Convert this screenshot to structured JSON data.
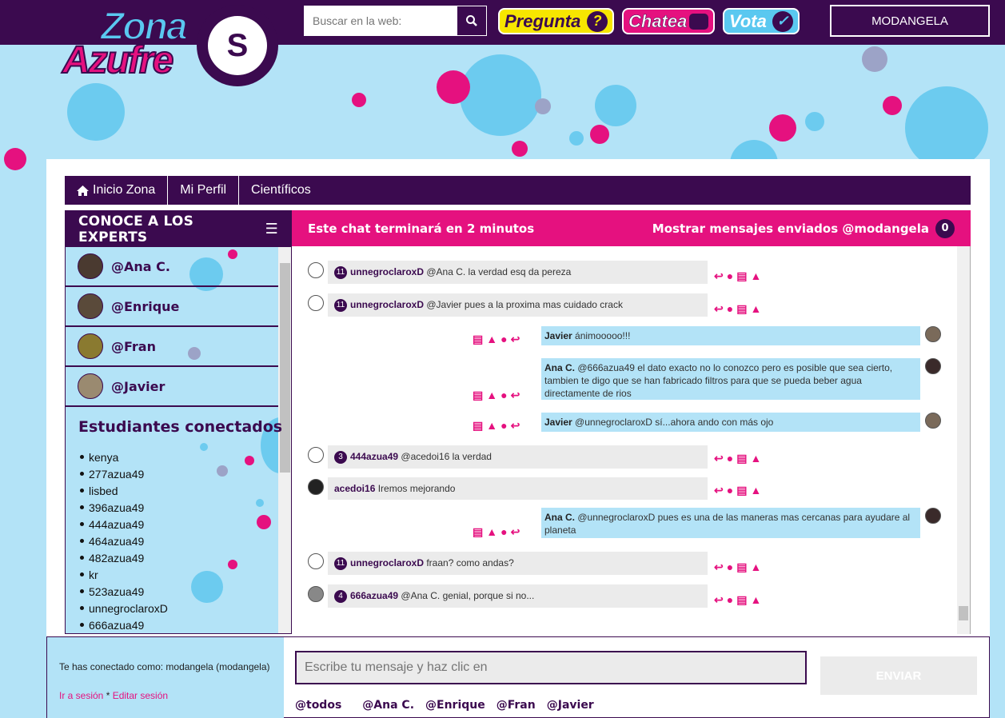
{
  "header": {
    "logo_zona": "Zona",
    "logo_azufre": "Azufre",
    "logo_badge": "S",
    "search_placeholder": "Buscar en la web:",
    "pregunta": "Pregunta",
    "pregunta_icon": "?",
    "chatea": "Chatea",
    "vota": "Vota",
    "vota_icon": "✓",
    "user": "MODANGELA"
  },
  "nav": {
    "home": "Inicio Zona",
    "profile": "Mi Perfil",
    "scientists": "Científicos"
  },
  "sidebar": {
    "title": "CONOCE A LOS EXPERTS",
    "experts": [
      "@Ana C.",
      "@Enrique",
      "@Fran",
      "@Javier"
    ],
    "students_title": "Estudiantes conectados",
    "students": [
      "kenya",
      "277azua49",
      "lisbed",
      "396azua49",
      "444azua49",
      "464azua49",
      "482azua49",
      "kr",
      "523azua49",
      "unnegroclaroxD",
      "666azua49"
    ]
  },
  "chat": {
    "timer": "Este chat terminará en 2 minutos",
    "show_sent": "Mostrar mensajes enviados @modangela",
    "sent_count": "0",
    "messages": [
      {
        "level": "11",
        "who": "unnegroclaroxD",
        "text": " @Ana C. la verdad esq da pereza"
      },
      {
        "level": "11",
        "who": "unnegroclaroxD",
        "text": " @Javier pues a la proxima mas cuidado crack"
      },
      {
        "who": "Javier",
        "text": " ánimooooo!!!"
      },
      {
        "who": "Ana C.",
        "text": " @666azua49 el dato exacto no lo conozco pero es posible que sea cierto, tambien te digo que se han fabricado filtros para que se pueda beber agua directamente de rios"
      },
      {
        "who": "Javier",
        "text": " @unnegroclaroxD sí...ahora ando con más ojo"
      },
      {
        "level": "3",
        "who": "444azua49",
        "text": " @acedoi16 la verdad"
      },
      {
        "level": "",
        "who": "acedoi16",
        "text": " Iremos mejorando"
      },
      {
        "who": "Ana C.",
        "text": " @unnegroclaroxD pues es una de las maneras mas cercanas para ayudare al planeta"
      },
      {
        "level": "11",
        "who": "unnegroclaroxD",
        "text": " fraan? como andas?"
      },
      {
        "level": "4",
        "who": "666azua49",
        "text": " @Ana C. genial, porque si no..."
      }
    ]
  },
  "footer": {
    "connected": "Te has conectado como: modangela (modangela)",
    "go_session": "Ir a sesión",
    "sep": " * ",
    "edit_session": "Editar sesión",
    "input_placeholder": "Escribe tu mensaje y haz clic en",
    "send": "ENVIAR",
    "mentions": [
      "@todos",
      "@Ana C.",
      "@Enrique",
      "@Fran",
      "@Javier"
    ]
  },
  "colors": {
    "purple": "#3b0a4f",
    "pink": "#e5117f",
    "light_blue": "#b3e3f7",
    "blue": "#5ac8f0"
  }
}
